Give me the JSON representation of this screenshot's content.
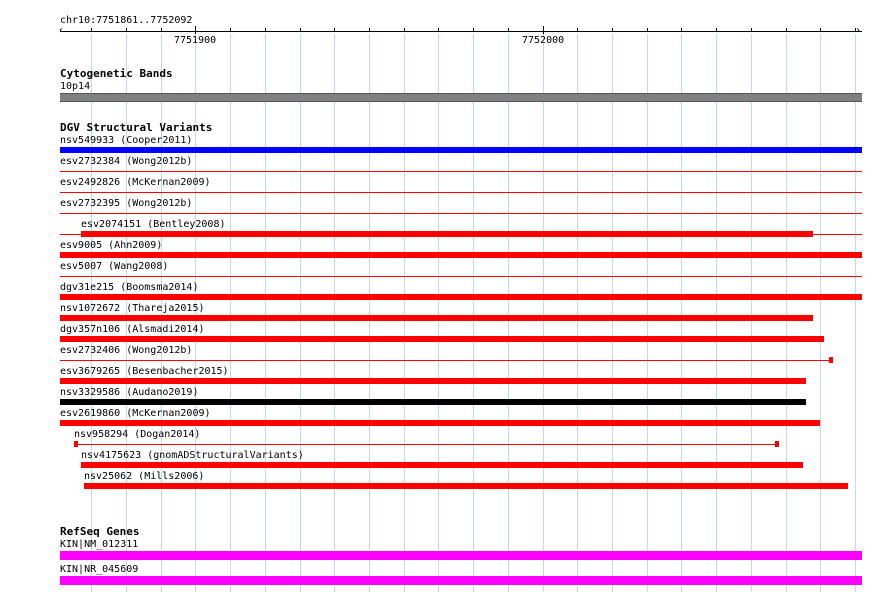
{
  "colors": {
    "grid": "#b5e1ee",
    "red": "#ff0000",
    "blue": "#0000ff",
    "black": "#000000",
    "gray": "#808080",
    "magenta": "#ff00ff"
  },
  "ruler": {
    "locus": "chr10:7751861..7752092",
    "start": 7751861,
    "end": 7752092,
    "major_ticks": [
      {
        "label": "7751900",
        "pos": 7751900
      },
      {
        "label": "7752000",
        "pos": 7752000
      }
    ]
  },
  "tracks": {
    "cytoband": {
      "title": "Cytogenetic Bands",
      "feature": {
        "label": "10p14",
        "start": 7751861,
        "end": 7752092,
        "color": "gray"
      }
    },
    "dgv": {
      "title": "DGV Structural Variants",
      "features": [
        {
          "label": "nsv549933 (Cooper2011)",
          "start": 7751861,
          "end": 7752092,
          "color": "blue",
          "kind": "thick"
        },
        {
          "label": "esv2732384 (Wong2012b)",
          "start": 7751861,
          "end": 7752092,
          "color": "red",
          "kind": "line"
        },
        {
          "label": "esv2492826 (McKernan2009)",
          "start": 7751861,
          "end": 7752092,
          "color": "red",
          "kind": "line"
        },
        {
          "label": "esv2732395 (Wong2012b)",
          "start": 7751861,
          "end": 7752092,
          "color": "red",
          "kind": "line"
        },
        {
          "label": "esv2074151 (Bentley2008)",
          "start": 7751867,
          "end": 7752078,
          "color": "red",
          "kind": "thick_tail"
        },
        {
          "label": "esv9005 (Ahn2009)",
          "start": 7751861,
          "end": 7752092,
          "color": "red",
          "kind": "thick"
        },
        {
          "label": "esv5007 (Wang2008)",
          "start": 7751861,
          "end": 7752092,
          "color": "red",
          "kind": "line"
        },
        {
          "label": "dgv31e215 (Boomsma2014)",
          "start": 7751861,
          "end": 7752092,
          "color": "red",
          "kind": "thick"
        },
        {
          "label": "nsv1072672 (Thareja2015)",
          "start": 7751861,
          "end": 7752078,
          "color": "red",
          "kind": "thick"
        },
        {
          "label": "dgv357n106 (Alsmadi2014)",
          "start": 7751861,
          "end": 7752081,
          "color": "red",
          "kind": "thick"
        },
        {
          "label": "esv2732406 (Wong2012b)",
          "start": 7751861,
          "end": 7752083,
          "color": "red",
          "kind": "line_cap"
        },
        {
          "label": "esv3679265 (Besenbacher2015)",
          "start": 7751861,
          "end": 7752076,
          "color": "red",
          "kind": "thick"
        },
        {
          "label": "nsv3329586 (Audano2019)",
          "start": 7751861,
          "end": 7752076,
          "color": "black",
          "kind": "thick"
        },
        {
          "label": "esv2619860 (McKernan2009)",
          "start": 7751861,
          "end": 7752080,
          "color": "red",
          "kind": "thick"
        },
        {
          "label": "nsv958294 (Dogan2014)",
          "start": 7751865,
          "end": 7752068,
          "color": "red",
          "kind": "dumbbell"
        },
        {
          "label": "nsv4175623 (gnomADStructuralVariants)",
          "start": 7751867,
          "end": 7752075,
          "color": "red",
          "kind": "thick"
        },
        {
          "label": "nsv25062 (Mills2006)",
          "start": 7751868,
          "end": 7752088,
          "color": "red",
          "kind": "thick"
        }
      ]
    },
    "refseq": {
      "title": "RefSeq Genes",
      "features": [
        {
          "label": "KIN|NM_012311",
          "start": 7751861,
          "end": 7752092,
          "color": "magenta"
        },
        {
          "label": "KIN|NR_045609",
          "start": 7751861,
          "end": 7752092,
          "color": "magenta"
        }
      ]
    }
  }
}
